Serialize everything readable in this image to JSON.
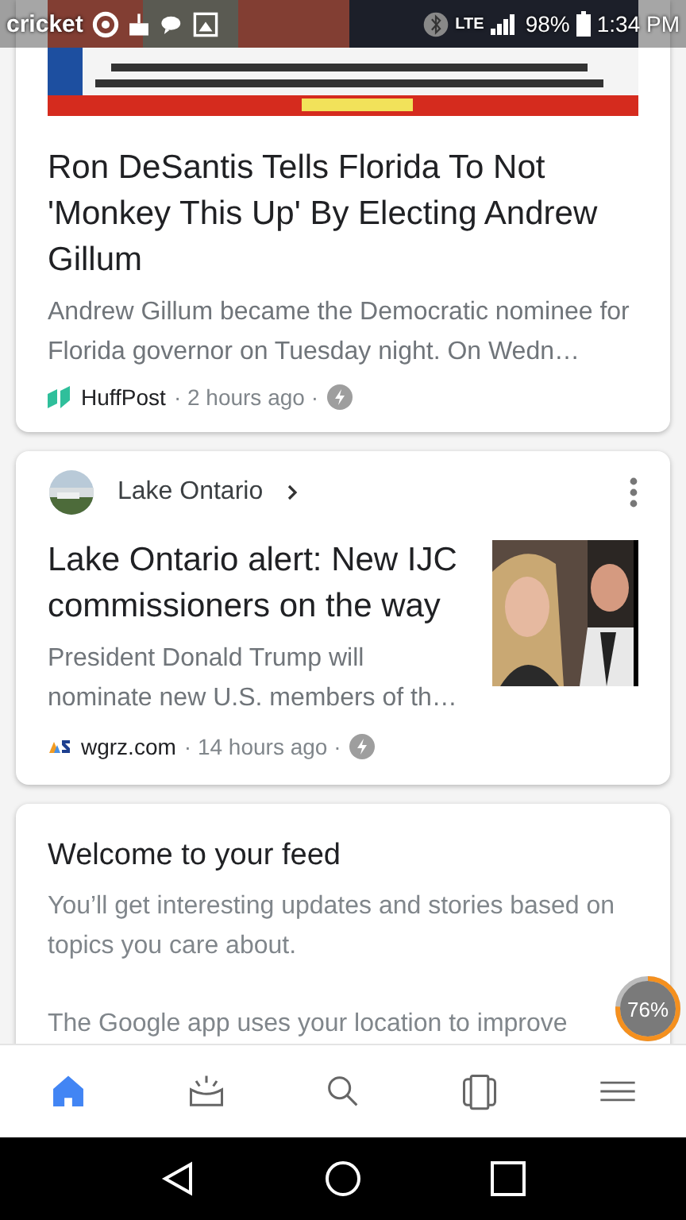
{
  "status_bar": {
    "carrier": "cricket",
    "battery": "98%",
    "time": "1:34 PM",
    "network": "LTE"
  },
  "cards": [
    {
      "kind": "hero",
      "headline": "Ron DeSantis Tells Florida To Not 'Monkey This Up' By Electing Andrew Gillum",
      "snippet": "Andrew Gillum became the Democratic nominee for Florida governor on Tuesday night. On Wedn…",
      "source": "HuffPost",
      "time": "· 2 hours ago ·"
    },
    {
      "kind": "topic",
      "topic": "Lake Ontario",
      "headline": "Lake Ontario alert: New IJC commissioners on the way",
      "snippet": "President Donald Trump will nominate new U.S. members of th…",
      "source": "wgrz.com",
      "time": "· 14 hours ago ·"
    },
    {
      "kind": "welcome",
      "headline": "Welcome to your feed",
      "paragraphs": [
        "You’ll get interesting updates and stories based on topics you care about.",
        "The Google app uses your location to improve"
      ]
    }
  ],
  "progress_badge": {
    "label": "76%",
    "level": 0.76
  },
  "bottom_nav": [
    {
      "kind": "home",
      "selected": true
    },
    {
      "kind": "updates",
      "selected": false
    },
    {
      "kind": "search",
      "selected": false
    },
    {
      "kind": "tabs",
      "selected": false
    },
    {
      "kind": "menu",
      "selected": false
    }
  ]
}
